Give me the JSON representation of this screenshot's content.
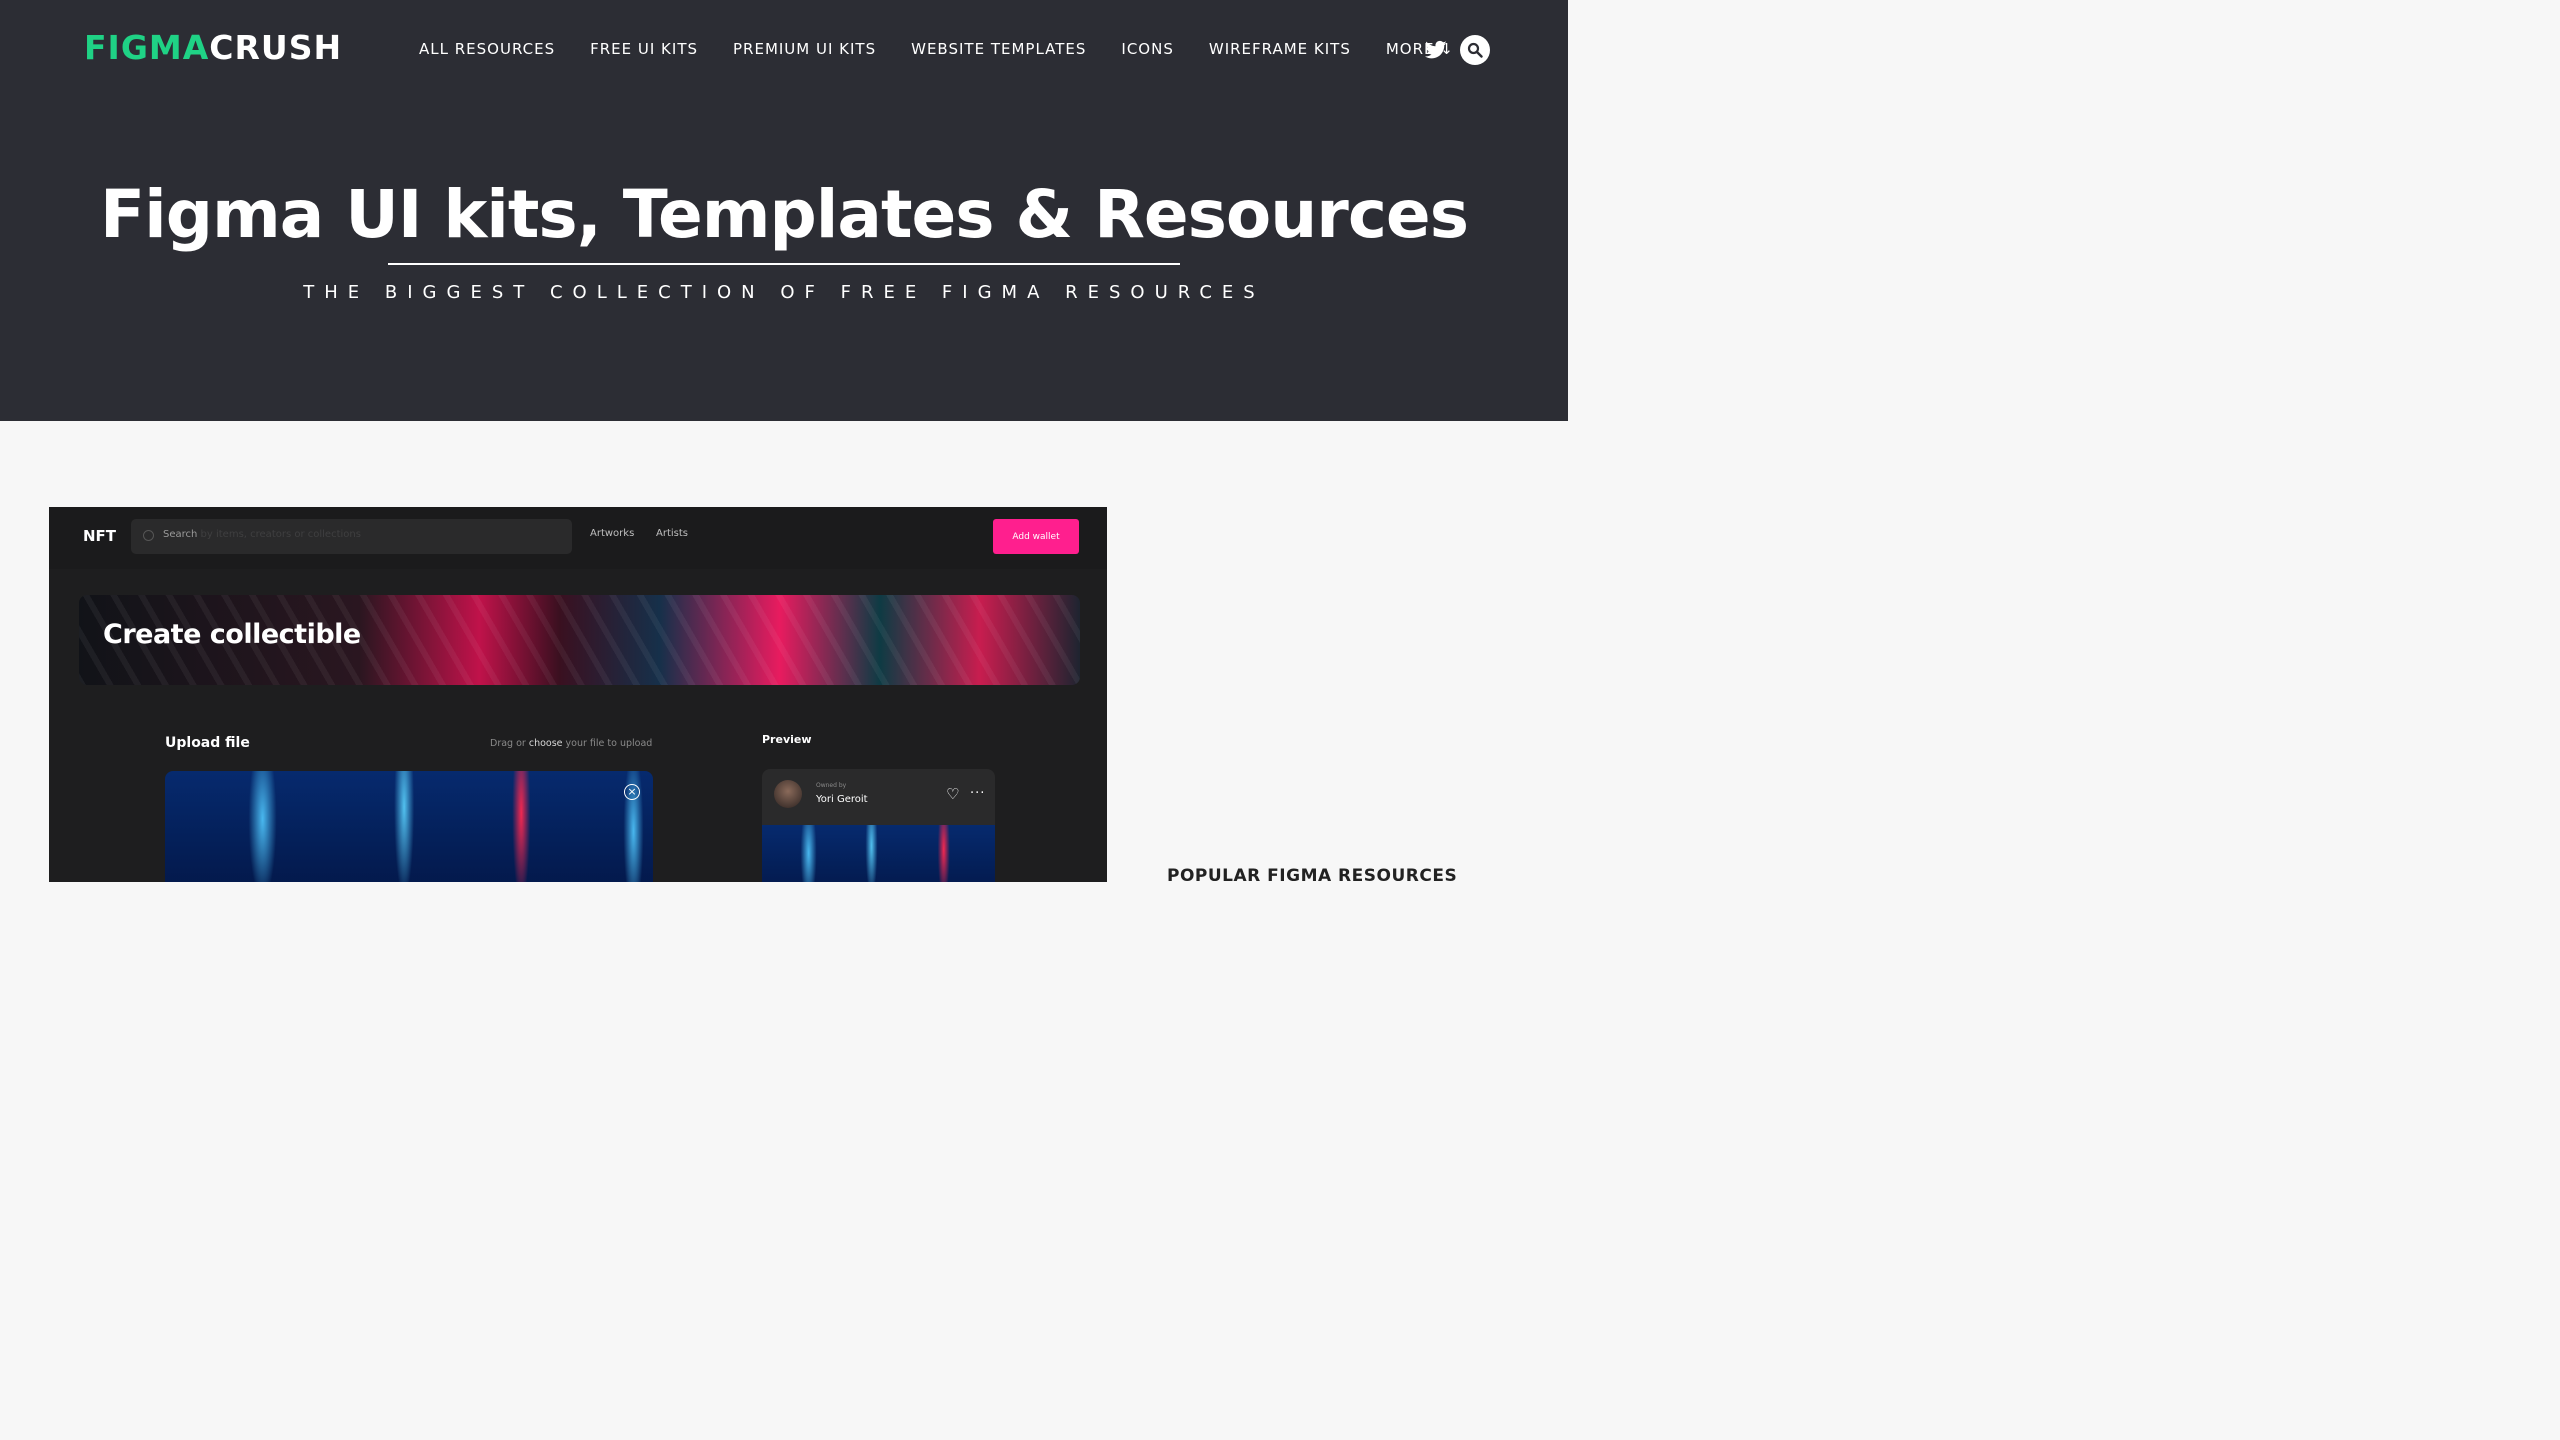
{
  "header": {
    "logo_green": "FIGMA",
    "logo_white": "CRUSH",
    "nav": [
      {
        "label": "ALL RESOURCES"
      },
      {
        "label": "FREE UI KITS"
      },
      {
        "label": "PREMIUM UI KITS"
      },
      {
        "label": "WEBSITE TEMPLATES"
      },
      {
        "label": "ICONS"
      },
      {
        "label": "WIREFRAME KITS"
      },
      {
        "label": "MORE ↓"
      }
    ],
    "icons": {
      "twitter": "twitter-icon",
      "search": "search-icon"
    }
  },
  "hero": {
    "title": "Figma UI kits, Templates & Resources",
    "subtitle": "THE BIGGEST COLLECTION OF FREE FIGMA RESOURCES"
  },
  "featured_preview": {
    "brand": "NFT",
    "search_prefix": "Search",
    "search_placeholder": " by items, creators or collections",
    "links": [
      "Artworks",
      "Artists"
    ],
    "wallet_button": "Add wallet",
    "banner_title": "Create collectible",
    "upload_label": "Upload file",
    "drag_prefix": "Drag or ",
    "drag_choose": "choose",
    "drag_suffix": " your file to upload",
    "preview_label": "Preview",
    "owned_by_label": "Owned by",
    "owner_name": "Yori Geroit"
  },
  "sidebar": {
    "heading": "POPULAR FIGMA RESOURCES"
  },
  "colors": {
    "header_bg": "#2c2d34",
    "brand_green": "#1fd285",
    "accent_pink": "#ff1f8e",
    "page_bg": "#f7f7f7"
  }
}
